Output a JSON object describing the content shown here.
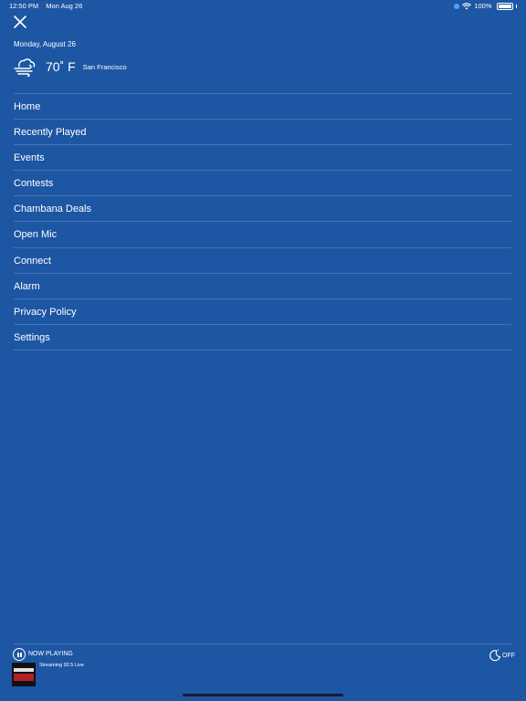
{
  "status_bar": {
    "time": "12:50 PM",
    "date": "Mon Aug 26",
    "battery": "100%"
  },
  "header": {
    "close_icon": "close-icon",
    "date": "Monday, August 26",
    "weather": {
      "icon": "windy-cloud-icon",
      "temperature": "70˚ F",
      "city": "San Francisco"
    }
  },
  "menu": {
    "items": [
      {
        "label": "Home"
      },
      {
        "label": "Recently Played"
      },
      {
        "label": "Events"
      },
      {
        "label": "Contests"
      },
      {
        "label": "Chambana Deals"
      },
      {
        "label": "Open Mic"
      },
      {
        "label": "Connect"
      },
      {
        "label": "Alarm"
      },
      {
        "label": "Privacy Policy"
      },
      {
        "label": "Settings"
      }
    ]
  },
  "player": {
    "now_playing": "NOW PLAYING",
    "stream": "Streaming 92.5 Live",
    "sleep_timer": "OFF"
  },
  "colors": {
    "background": "#1d56a3",
    "text": "#ffffff"
  }
}
